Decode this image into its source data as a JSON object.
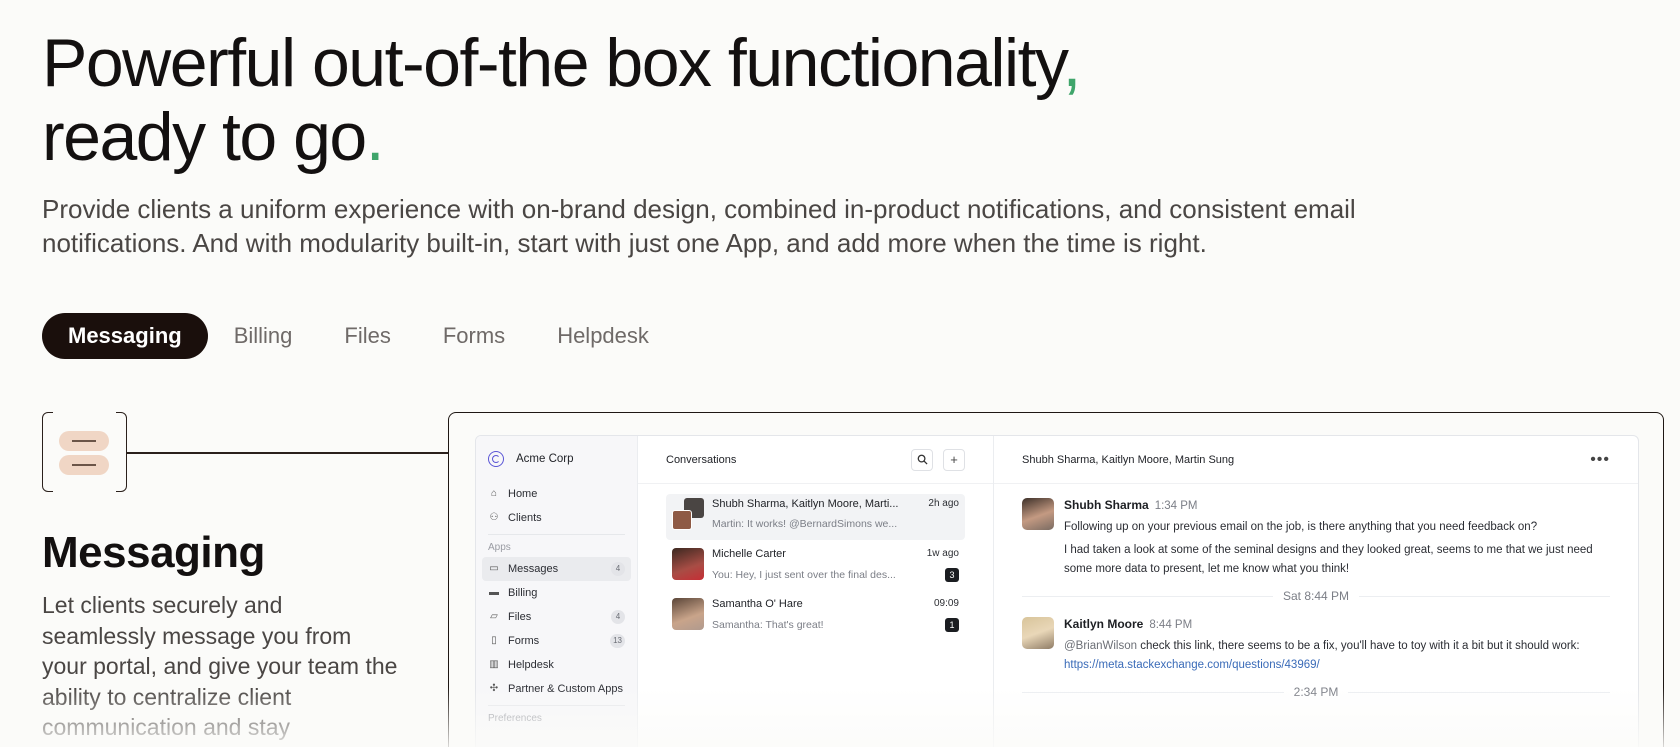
{
  "hero": {
    "title_line1": "Powerful out-of-the box functionality",
    "title_comma": ",",
    "title_line2": "ready to go",
    "title_period": ".",
    "subtitle": "Provide clients a uniform experience with on-brand design, combined in-product notifications, and consistent email notifications. And with modularity built-in, start with just one App, and add more when the time is right."
  },
  "tabs": [
    {
      "label": "Messaging",
      "active": true
    },
    {
      "label": "Billing",
      "active": false
    },
    {
      "label": "Files",
      "active": false
    },
    {
      "label": "Forms",
      "active": false
    },
    {
      "label": "Helpdesk",
      "active": false
    }
  ],
  "feature": {
    "title": "Messaging",
    "description": "Let clients securely and seamlessly message you from your portal, and give your team the ability to centralize client communication and stay"
  },
  "app": {
    "org_name": "Acme Corp",
    "nav": {
      "home": "Home",
      "clients": "Clients",
      "apps_label": "Apps",
      "messages": "Messages",
      "messages_badge": "4",
      "billing": "Billing",
      "files": "Files",
      "files_badge": "4",
      "forms": "Forms",
      "forms_badge": "13",
      "helpdesk": "Helpdesk",
      "partner_apps": "Partner & Custom Apps",
      "preferences_label": "Preferences"
    },
    "conversations": {
      "title": "Conversations",
      "items": [
        {
          "name": "Shubh Sharma, Kaitlyn Moore, Marti...",
          "time": "2h ago",
          "preview": "Martin: It works! @BernardSimons we...",
          "count": ""
        },
        {
          "name": "Michelle Carter",
          "time": "1w ago",
          "preview": "You: Hey, I just sent over the final des...",
          "count": "3"
        },
        {
          "name": "Samantha O' Hare",
          "time": "09:09",
          "preview": "Samantha: That's great!",
          "count": "1"
        }
      ]
    },
    "thread": {
      "title": "Shubh Sharma, Kaitlyn Moore, Martin Sung",
      "msg1": {
        "name": "Shubh Sharma",
        "time": "1:34 PM",
        "text1": "Following up on your previous email on the job, is there anything that you need feedback on?",
        "text2": "I had taken a look at some of the seminal designs and they looked great, seems to me that we just need some more data to present, let me know what you think!"
      },
      "divider1": "Sat 8:44 PM",
      "msg2": {
        "name": "Kaitlyn Moore",
        "time": "8:44 PM",
        "mention": "@BrianWilson",
        "text": " check this link, there seems to be a fix, you'll have to toy with it a bit but it should work: ",
        "link": "https://meta.stackexchange.com/questions/43969/"
      },
      "divider2": "2:34 PM"
    }
  },
  "colors": {
    "accent_green": "#3fa56b",
    "tab_active_bg": "#1a0f0c",
    "icon_bar": "#f0d6c5"
  }
}
